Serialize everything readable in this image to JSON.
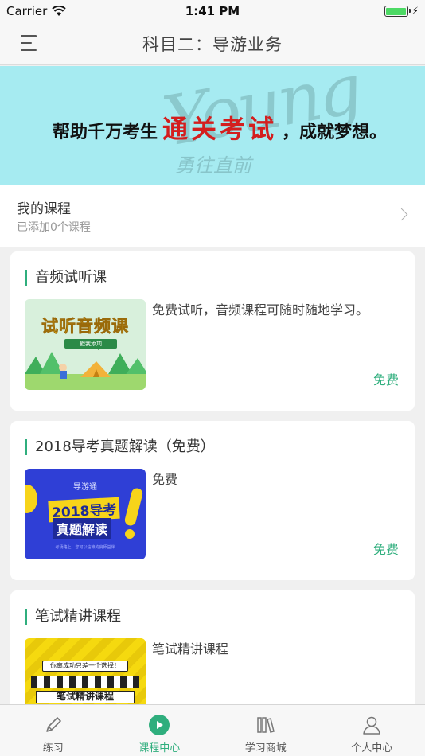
{
  "status_bar": {
    "carrier": "Carrier",
    "time": "1:41 PM",
    "battery_level": 1.0
  },
  "nav": {
    "title": "科目二：导游业务",
    "menu_icon": "hamburger-menu-icon"
  },
  "banner": {
    "text_before": "帮助千万考生",
    "text_highlight": "通关考试",
    "text_after": "，成就梦想。",
    "watermark": "Young",
    "watermark_sub": "勇往直前",
    "highlight_color": "#d41e1e",
    "background_color": "#a6ebf1"
  },
  "my_course": {
    "title": "我的课程",
    "subtitle": "已添加0个课程"
  },
  "courses": [
    {
      "title": "音频试听课",
      "description": "免费试听，音频课程可随时随地学习。",
      "price": "免费",
      "thumb": {
        "title": "试听音频课",
        "badge": "戳我添加"
      }
    },
    {
      "title": "2018导考真题解读（免费）",
      "description": "免费",
      "price": "免费",
      "thumb": {
        "top": "导游通",
        "main": "2018导考",
        "sub": "真题解读",
        "foot": "考场路上，您可以信赖的良师益伴"
      }
    },
    {
      "title": "笔试精讲课程",
      "description": "笔试精讲课程",
      "price": "",
      "thumb": {
        "top": "你离成功只差一个选择！",
        "main": "笔试精讲课程"
      }
    }
  ],
  "tabs": [
    {
      "label": "练习",
      "icon": "pencil-icon",
      "active": false
    },
    {
      "label": "课程中心",
      "icon": "play-circle-icon",
      "active": true
    },
    {
      "label": "学习商城",
      "icon": "books-icon",
      "active": false
    },
    {
      "label": "个人中心",
      "icon": "person-icon",
      "active": false
    }
  ],
  "colors": {
    "accent": "#2fae7d",
    "price": "#2fae7d"
  }
}
